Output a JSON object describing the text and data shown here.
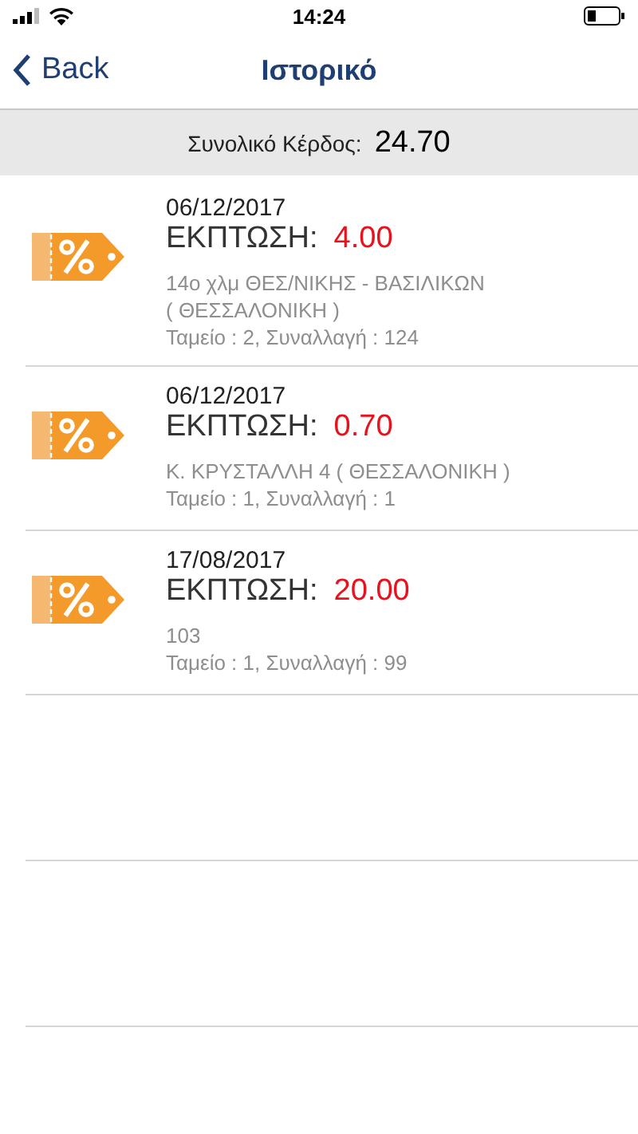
{
  "status_bar": {
    "time": "14:24"
  },
  "nav": {
    "back": "Back",
    "title": "Ιστορικό"
  },
  "summary": {
    "label": "Συνολικό Κέρδος:",
    "value": "24.70"
  },
  "transactions": [
    {
      "date": "06/12/2017",
      "label": "ΕΚΠΤΩΣΗ:",
      "amount": "4.00",
      "address_lines": [
        "14ο χλμ ΘΕΣ/ΝΙΚΗΣ - ΒΑΣΙΛΙΚΩΝ",
        "( ΘΕΣΣΑΛΟΝΙΚΗ )"
      ],
      "details": "Ταμείο : 2, Συναλλαγή : 124"
    },
    {
      "date": "06/12/2017",
      "label": "ΕΚΠΤΩΣΗ:",
      "amount": "0.70",
      "address_lines": [
        "Κ. ΚΡΥΣΤΑΛΛΗ 4 ( ΘΕΣΣΑΛΟΝΙΚΗ )"
      ],
      "details": "Ταμείο : 1, Συναλλαγή : 1"
    },
    {
      "date": "17/08/2017",
      "label": "ΕΚΠΤΩΣΗ:",
      "amount": "20.00",
      "address_lines": [
        "103"
      ],
      "details": "Ταμείο : 1, Συναλλαγή : 99"
    }
  ]
}
